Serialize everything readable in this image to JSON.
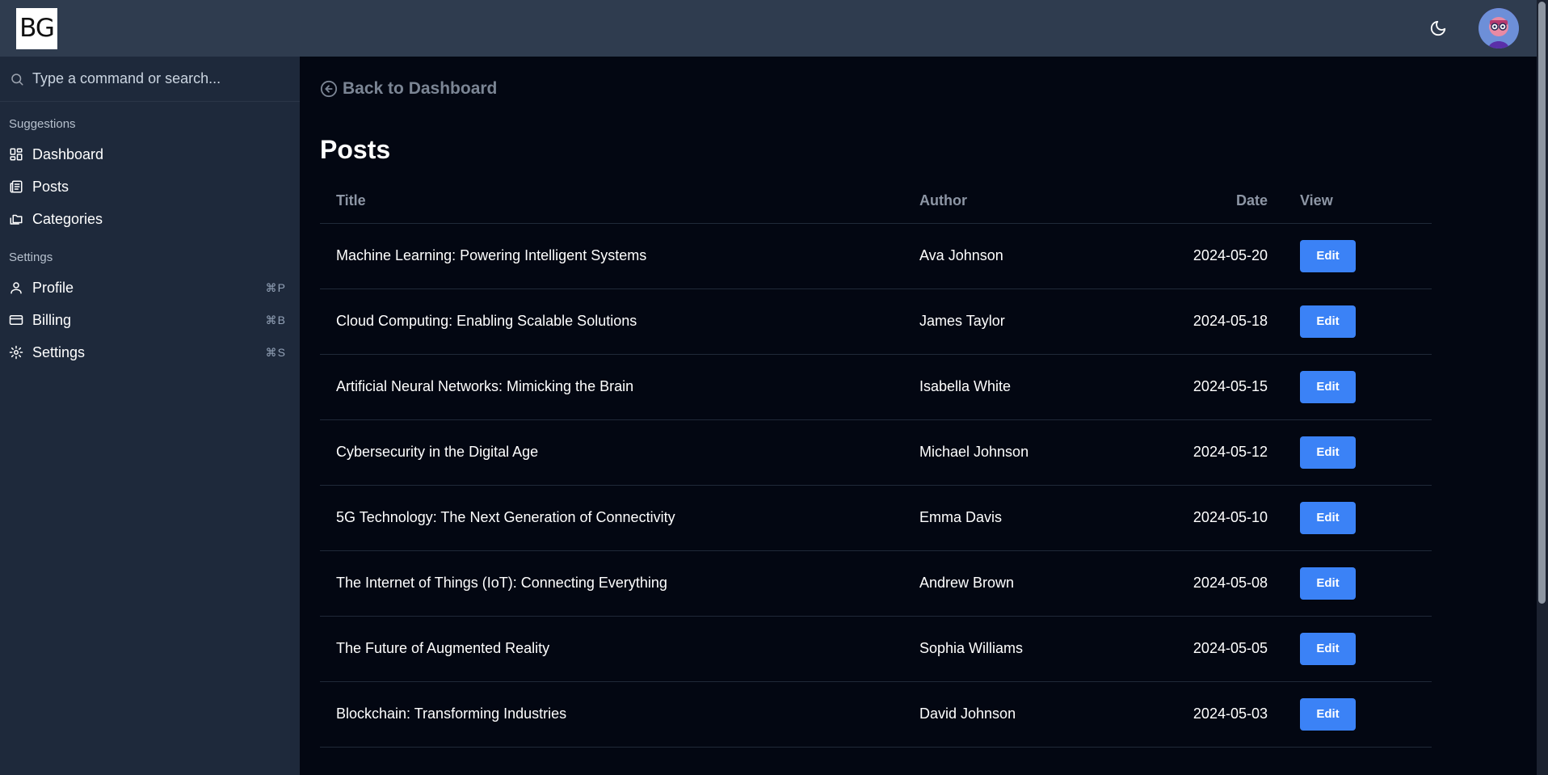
{
  "header": {
    "logo_text": "BG",
    "theme_icon": "moon-icon",
    "avatar_icon": "avatar-image"
  },
  "sidebar": {
    "search": {
      "placeholder": "Type a command or search..."
    },
    "suggestions_label": "Suggestions",
    "suggestions": [
      {
        "label": "Dashboard",
        "icon": "dashboard-icon"
      },
      {
        "label": "Posts",
        "icon": "posts-icon"
      },
      {
        "label": "Categories",
        "icon": "folders-icon"
      }
    ],
    "settings_label": "Settings",
    "settings": [
      {
        "label": "Profile",
        "icon": "user-icon",
        "shortcut": "⌘P"
      },
      {
        "label": "Billing",
        "icon": "credit-card-icon",
        "shortcut": "⌘B"
      },
      {
        "label": "Settings",
        "icon": "gear-icon",
        "shortcut": "⌘S"
      }
    ]
  },
  "main": {
    "back_label": "Back to Dashboard",
    "title": "Posts",
    "columns": [
      "Title",
      "Author",
      "Date",
      "View"
    ],
    "edit_label": "Edit",
    "rows": [
      {
        "title": "Machine Learning: Powering Intelligent Systems",
        "author": "Ava Johnson",
        "date": "2024-05-20"
      },
      {
        "title": "Cloud Computing: Enabling Scalable Solutions",
        "author": "James Taylor",
        "date": "2024-05-18"
      },
      {
        "title": "Artificial Neural Networks: Mimicking the Brain",
        "author": "Isabella White",
        "date": "2024-05-15"
      },
      {
        "title": "Cybersecurity in the Digital Age",
        "author": "Michael Johnson",
        "date": "2024-05-12"
      },
      {
        "title": "5G Technology: The Next Generation of Connectivity",
        "author": "Emma Davis",
        "date": "2024-05-10"
      },
      {
        "title": "The Internet of Things (IoT): Connecting Everything",
        "author": "Andrew Brown",
        "date": "2024-05-08"
      },
      {
        "title": "The Future of Augmented Reality",
        "author": "Sophia Williams",
        "date": "2024-05-05"
      },
      {
        "title": "Blockchain: Transforming Industries",
        "author": "David Johnson",
        "date": "2024-05-03"
      }
    ]
  },
  "colors": {
    "topbar": "#2f3c4f",
    "sidebar": "#1e293b",
    "main_bg": "#030712",
    "accent": "#3b82f6"
  }
}
